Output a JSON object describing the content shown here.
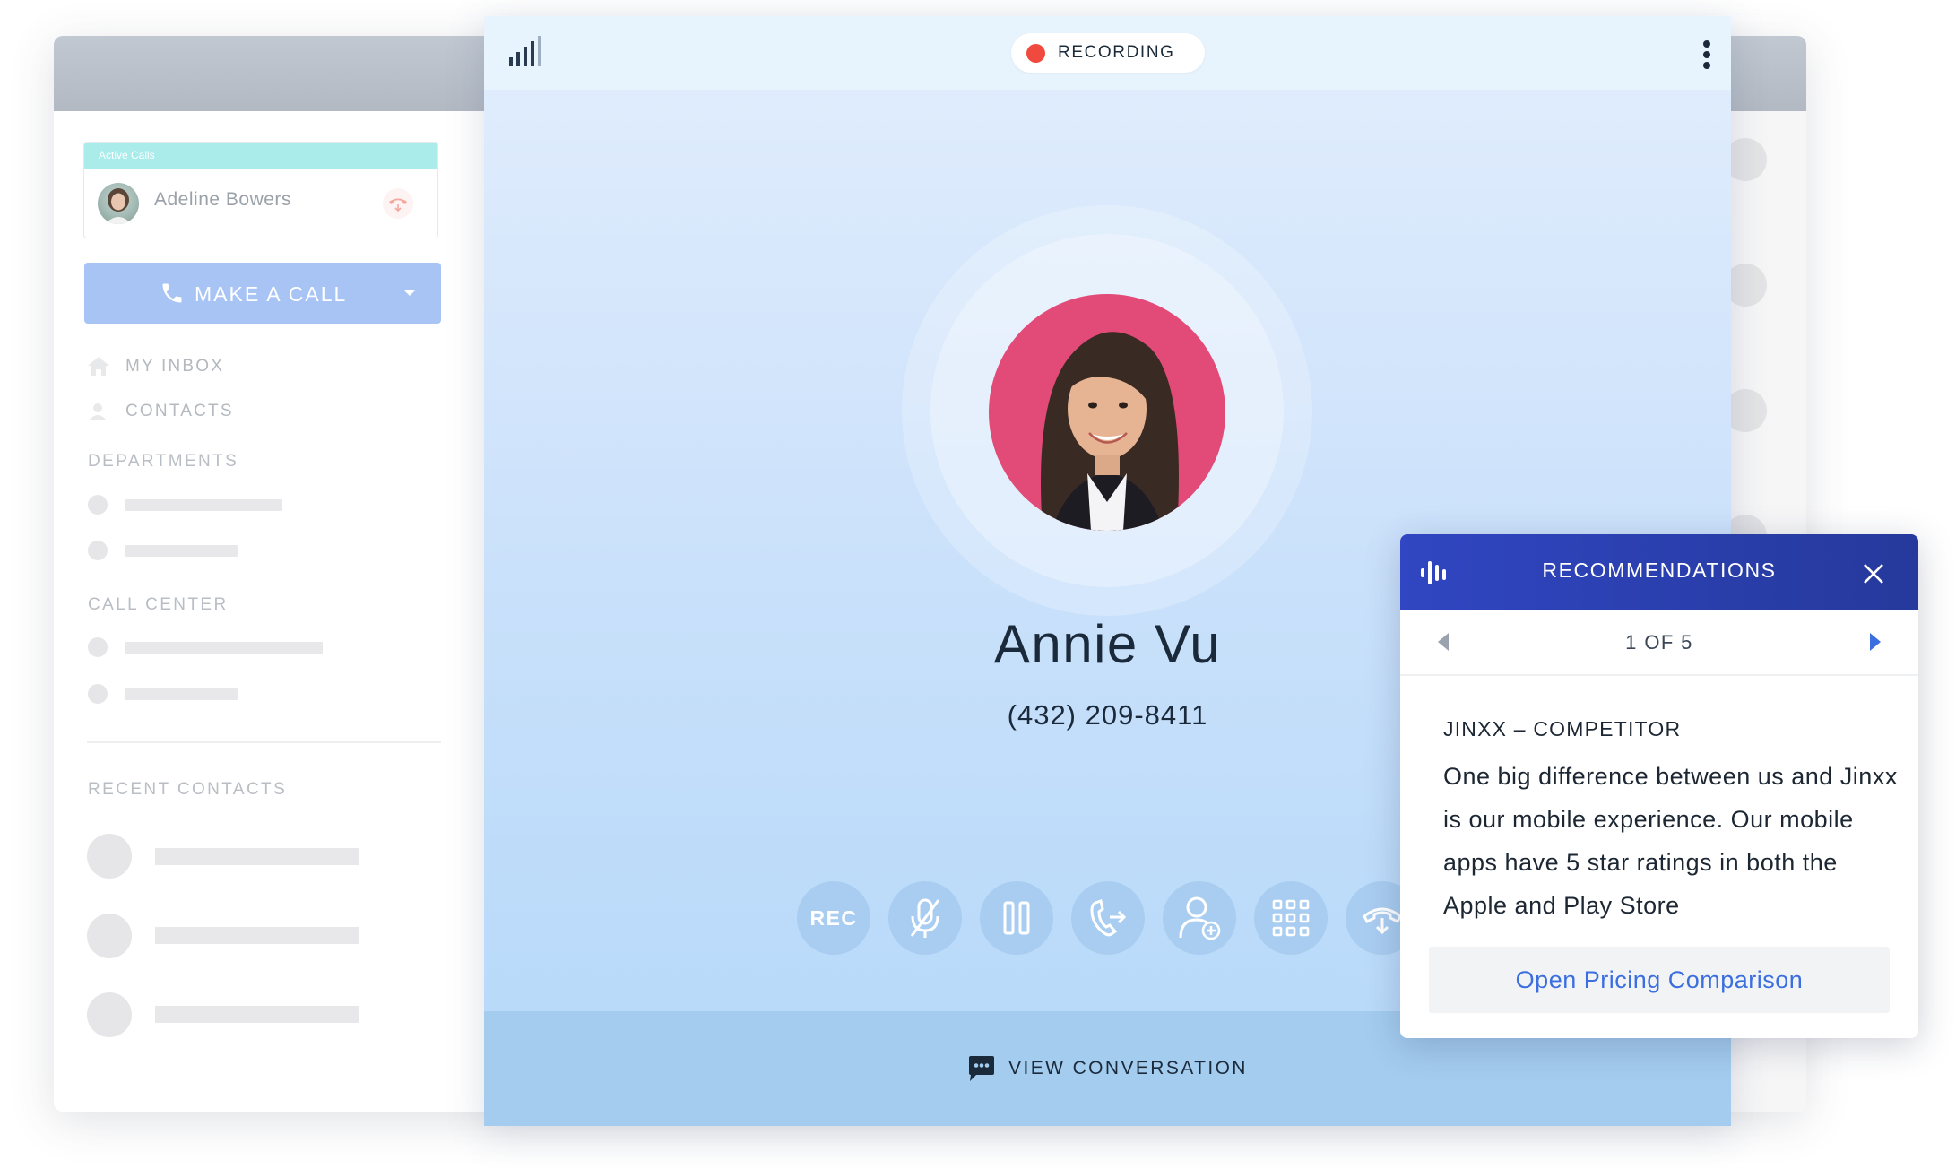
{
  "sidebar": {
    "active_calls": {
      "header": "Active Calls",
      "caller_name": "Adeline Bowers"
    },
    "make_call_label": "MAKE A CALL",
    "nav": {
      "inbox": "MY INBOX",
      "contacts": "CONTACTS"
    },
    "sections": {
      "departments": "DEPARTMENTS",
      "call_center": "CALL CENTER",
      "recent_contacts": "RECENT CONTACTS"
    }
  },
  "call": {
    "status": "RECORDING",
    "contact_name": "Annie Vu",
    "contact_phone": "(432) 209-8411",
    "controls": {
      "rec_label": "REC"
    },
    "view_conversation": "VIEW CONVERSATION"
  },
  "recommendations": {
    "title": "RECOMMENDATIONS",
    "pager": "1 OF 5",
    "topic": "JINXX – COMPETITOR",
    "body": "One big difference between us and Jinxx is our mobile experience. Our mobile apps have 5 star ratings in both the Apple and Play Store",
    "action": "Open Pricing Comparison"
  },
  "colors": {
    "recording_dot": "#f0493d",
    "accent_blue": "#3b6fe0",
    "recommendations_header": "#2b3fb0",
    "contact_photo_bg": "#e24a78",
    "make_call_button": "#a7c4f5",
    "active_calls_header": "#a9ecea"
  },
  "icons": {
    "signal": "signal-strength-icon",
    "menu": "kebab-menu-icon",
    "mute": "microphone-off-icon",
    "hold": "pause-icon",
    "transfer": "transfer-call-icon",
    "add_person": "add-person-icon",
    "keypad": "keypad-icon",
    "hang_up": "hang-up-icon",
    "chat": "chat-bubble-icon",
    "waveform": "waveform-icon",
    "close": "close-icon"
  }
}
